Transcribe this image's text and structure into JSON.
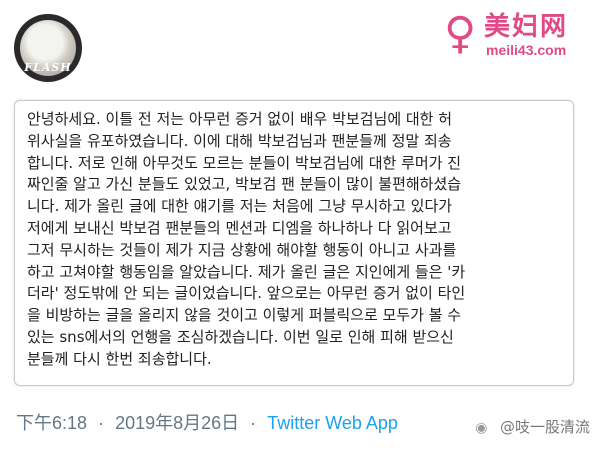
{
  "profile": {
    "avatar_text": "FLASH"
  },
  "watermark": {
    "cn": "美妇网",
    "url": "meili43.com"
  },
  "tweet": {
    "lines": [
      "안녕하세요. 이틀 전 저는 아무런 증거 없이 배우 박보검님에 대한 허",
      "위사실을 유포하였습니다. 이에 대해 박보검님과 팬분들께 정말 죄송",
      "합니다. 저로 인해 아무것도 모르는 분들이 박보검님에 대한 루머가 진",
      "짜인줄 알고 가신 분들도 있었고, 박보검 팬 분들이 많이 불편해하셨습",
      "니다. 제가 올린 글에 대한 얘기를 저는 처음에 그냥 무시하고 있다가",
      "저에게 보내신 박보검 팬분들의 멘션과 디엠을 하나하나 다 읽어보고",
      "그저 무시하는 것들이 제가 지금 상황에 해야할 행동이 아니고 사과를",
      "하고 고쳐야할 행동임을 알았습니다. 제가 올린 글은 지인에게 들은 '카",
      "더라' 정도밖에 안 되는 글이었습니다. 앞으로는 아무런 증거 없이 타인",
      "을 비방하는 글을 올리지 않을 것이고 이렇게 퍼블릭으로 모두가 볼 수",
      "있는 sns에서의 언행을 조심하겠습니다. 이번 일로 인해 피해 받으신",
      "분들께 다시 한번 죄송합니다."
    ]
  },
  "footer": {
    "time": "下午6:18",
    "separator": "·",
    "date": "2019年8月26日",
    "source": "Twitter Web App"
  },
  "weibo_watermark": {
    "icon": "weibo-icon",
    "text": "@吱一股清流"
  },
  "colors": {
    "accent": "#1da1f2",
    "muted": "#657786",
    "watermark": "#e04a86"
  }
}
